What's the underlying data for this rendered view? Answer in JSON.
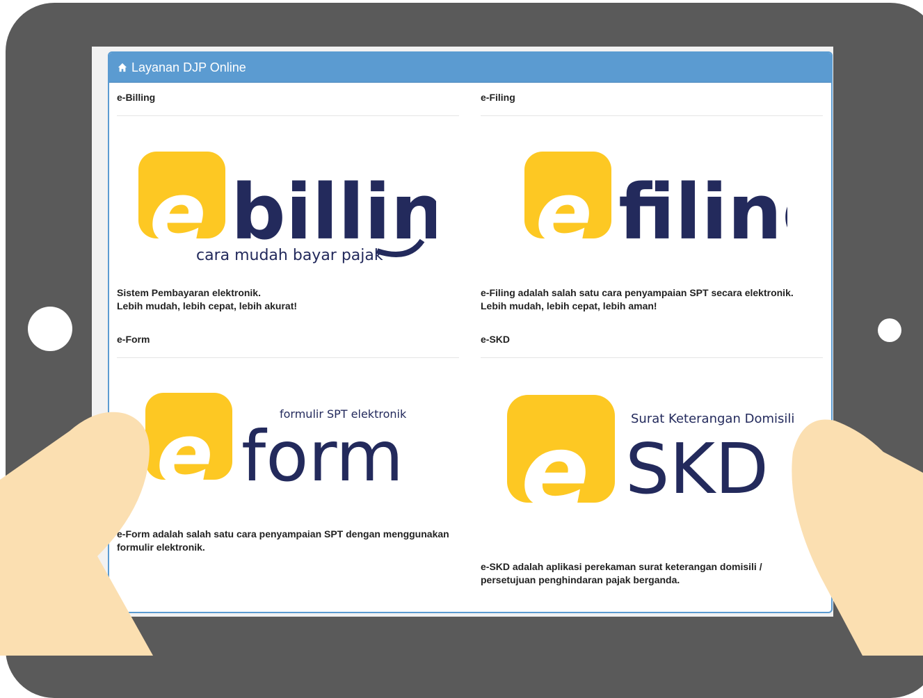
{
  "panel": {
    "title": "Layanan DJP Online"
  },
  "services": [
    {
      "title": "e-Billing",
      "logo_word": "billing",
      "logo_tagline": "cara mudah bayar pajak",
      "desc_line1": "Sistem Pembayaran elektronik.",
      "desc_line2": "Lebih mudah, lebih cepat, lebih akurat!"
    },
    {
      "title": "e-Filing",
      "logo_word": "filing",
      "desc_line1": "e-Filing adalah salah satu cara penyampaian SPT secara elektronik.",
      "desc_line2": "Lebih mudah, lebih cepat, lebih aman!"
    },
    {
      "title": "e-Form",
      "logo_word": "form",
      "logo_tagline": "formulir SPT elektronik",
      "desc_line1": "e-Form adalah salah satu cara penyampaian SPT dengan menggunakan",
      "desc_line2": "formulir elektronik."
    },
    {
      "title": "e-SKD",
      "logo_word": "SKD",
      "logo_tagline": "Surat Keterangan Domisili",
      "desc_line1": "e-SKD adalah aplikasi perekaman surat keterangan domisili /",
      "desc_line2": "persetujuan penghindaran pajak berganda."
    }
  ],
  "colors": {
    "tablet": "#5a5a5a",
    "header": "#5b9bd1",
    "logo_yellow": "#fdc823",
    "logo_navy": "#232a5c",
    "skin": "#fbdfb1"
  },
  "icons": {
    "header": "home-icon",
    "logo_mark": "e-letter-icon"
  }
}
